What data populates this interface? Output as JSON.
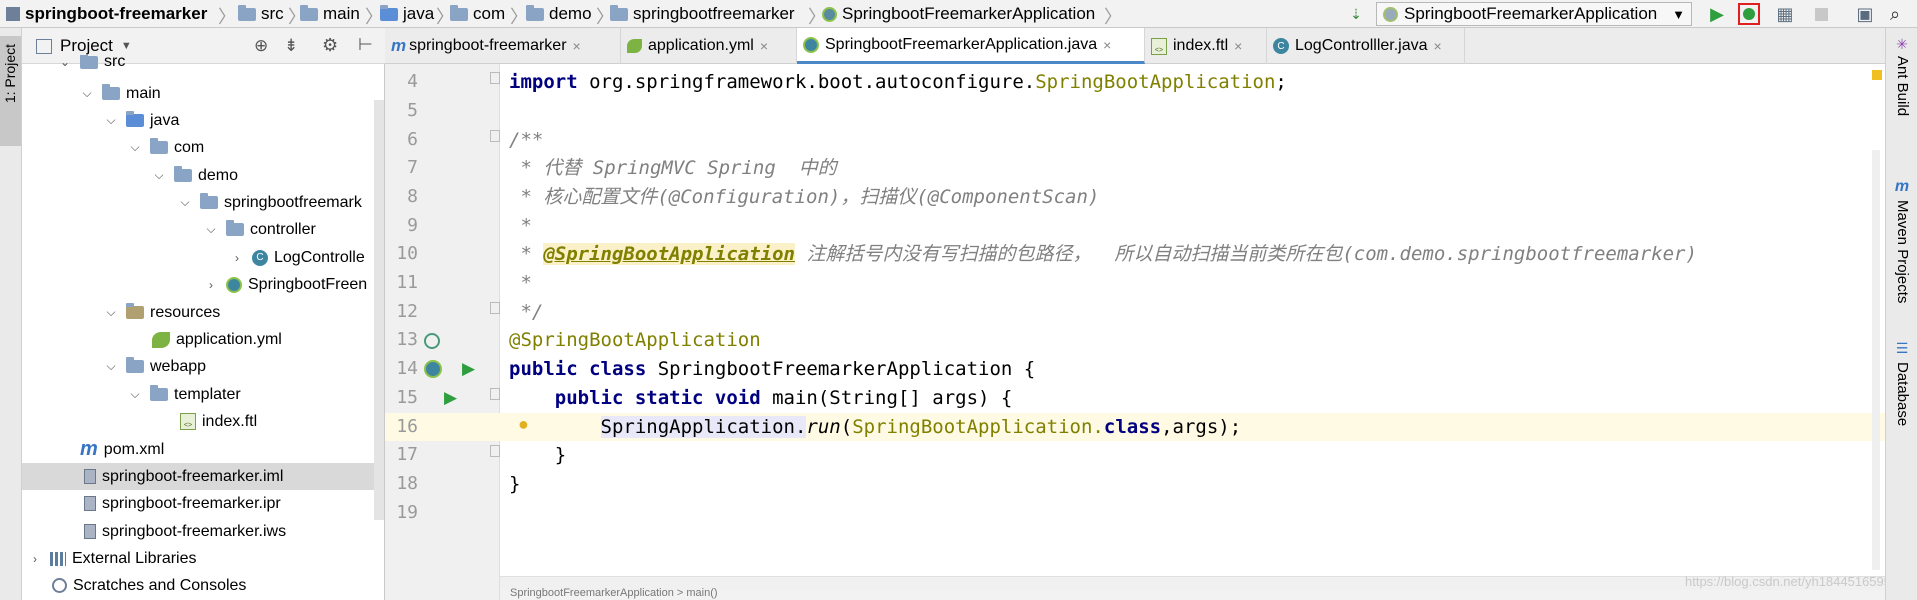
{
  "navbar": {
    "crumbs": [
      "springboot-freemarker",
      "src",
      "main",
      "java",
      "com",
      "demo",
      "springbootfreemarker",
      "SpringbootFreemarkerApplication"
    ],
    "run_config": "SpringbootFreemarkerApplication"
  },
  "left_strip": {
    "label": "1: Project"
  },
  "project_panel": {
    "title": "Project",
    "tree": [
      {
        "label": "src",
        "icon": "folder-icon"
      },
      {
        "label": "main",
        "icon": "folder-icon"
      },
      {
        "label": "java",
        "icon": "folder-icon"
      },
      {
        "label": "com",
        "icon": "package-icon"
      },
      {
        "label": "demo",
        "icon": "package-icon"
      },
      {
        "label": "springbootfreemark",
        "icon": "package-icon"
      },
      {
        "label": "controller",
        "icon": "package-icon"
      },
      {
        "label": "LogControlle",
        "icon": "class-icon"
      },
      {
        "label": "SpringbootFreen",
        "icon": "springboot-class-icon"
      },
      {
        "label": "resources",
        "icon": "folder-icon"
      },
      {
        "label": "application.yml",
        "icon": "yml-icon"
      },
      {
        "label": "webapp",
        "icon": "folder-icon"
      },
      {
        "label": "templater",
        "icon": "folder-icon"
      },
      {
        "label": "index.ftl",
        "icon": "ftl-icon"
      },
      {
        "label": "pom.xml",
        "icon": "maven-icon"
      },
      {
        "label": "springboot-freemarker.iml",
        "icon": "iml-icon"
      },
      {
        "label": "springboot-freemarker.ipr",
        "icon": "iml-icon"
      },
      {
        "label": "springboot-freemarker.iws",
        "icon": "iml-icon"
      },
      {
        "label": "External Libraries",
        "icon": "library-icon"
      },
      {
        "label": "Scratches and Consoles",
        "icon": "scratches-icon"
      }
    ]
  },
  "tabs": [
    {
      "label": "springboot-freemarker"
    },
    {
      "label": "application.yml"
    },
    {
      "label": "SpringbootFreemarkerApplication.java"
    },
    {
      "label": "index.ftl"
    },
    {
      "label": "LogControlller.java"
    }
  ],
  "editor": {
    "line_numbers": [
      "4",
      "5",
      "6",
      "7",
      "8",
      "9",
      "10",
      "11",
      "12",
      "13",
      "14",
      "15",
      "16",
      "17",
      "18",
      "19"
    ],
    "l4": {
      "kw": "import",
      "pkg": " org.springframework.boot.autoconfigure.",
      "cls": "SpringBootApplication",
      "semi": ";"
    },
    "l6": "/**",
    "l7": " * 代替 SpringMVC Spring  中的",
    "l8": " * 核心配置文件(@Configuration)，扫描仪(@ComponentScan)",
    "l9": " *",
    "l10": {
      "star": " * ",
      "ann": "@SpringBootApplication",
      "rest": " 注解括号内没有写扫描的包路径，  所以自动扫描当前类所在包(com.demo.springbootfreemarker)"
    },
    "l11": " *",
    "l12": " */",
    "l13": "@SpringBootApplication",
    "l14": {
      "kw": "public class",
      "rest": " SpringbootFreemarkerApplication {"
    },
    "l15": {
      "indent": "    ",
      "kw": "public static void",
      "rest": " main(String[] args) {"
    },
    "l16": {
      "indent": "        ",
      "obj": "SpringApplication.",
      "method": "run",
      "open": "(",
      "ann": "SpringBootApplication.",
      "kw": "class",
      "rest": ",args);"
    },
    "l17": "    }",
    "l18": "}"
  },
  "right_strip": [
    "Ant Build",
    "Maven Projects",
    "Database"
  ],
  "watermark": "https://blog.csdn.net/yh18445165959",
  "status_text": "SpringbootFreemarkerApplication > main()"
}
